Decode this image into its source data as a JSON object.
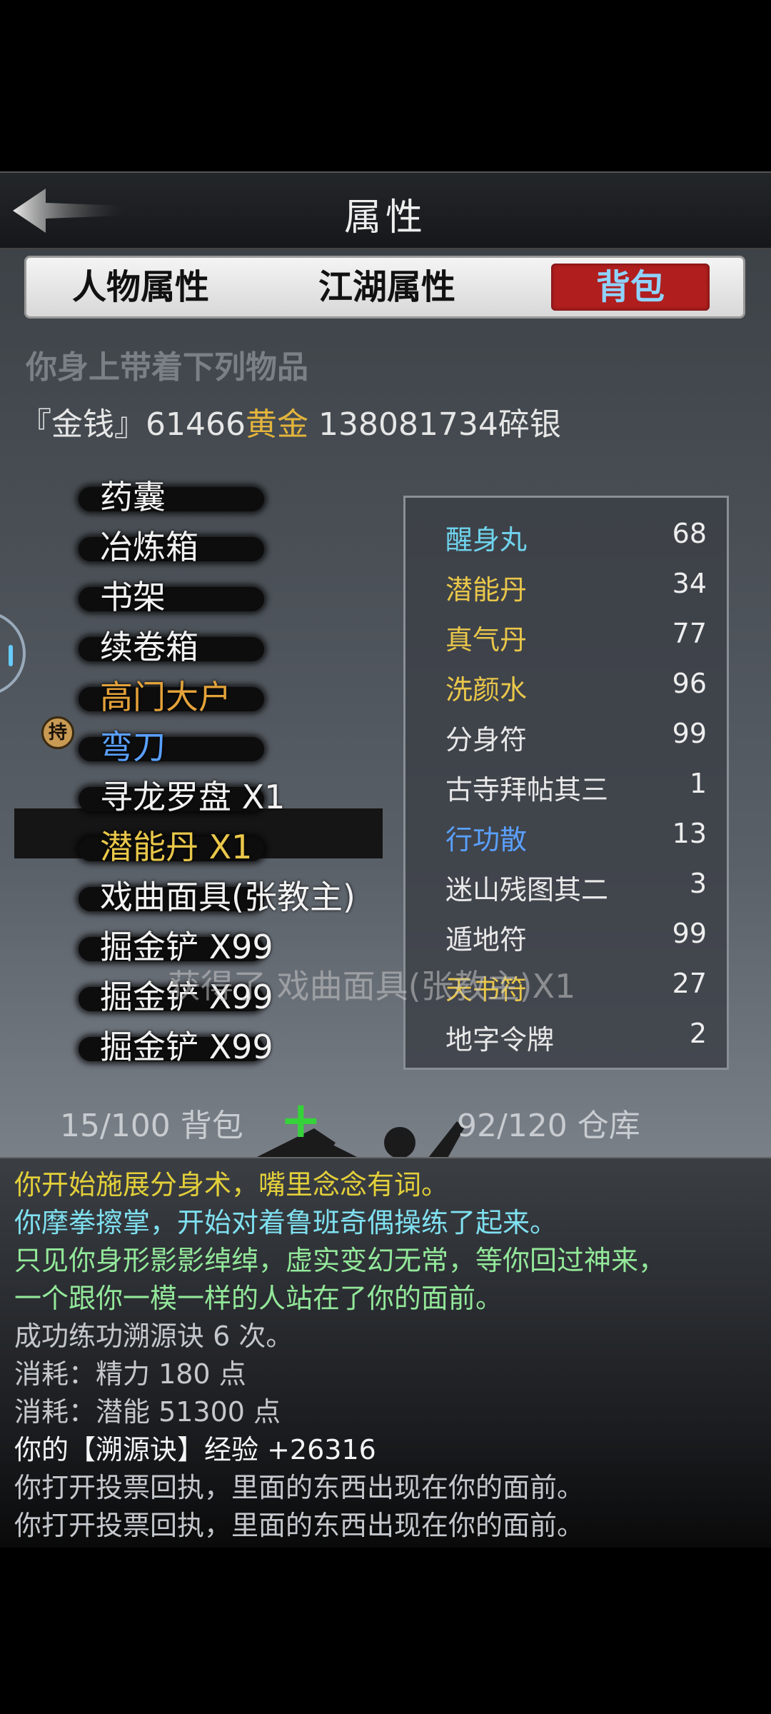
{
  "header": {
    "title": "属性"
  },
  "tabs": [
    {
      "label": "人物属性",
      "active": false
    },
    {
      "label": "江湖属性",
      "active": false
    },
    {
      "label": "背包",
      "active": true
    }
  ],
  "subtitle": "你身上带着下列物品",
  "money": {
    "prefix": "『金钱』61466",
    "gold_label": "黄金",
    "suffix": " 138081734碎银"
  },
  "equip_badge": "持",
  "items": [
    {
      "label": "药囊",
      "color": "#f2f2f2"
    },
    {
      "label": "冶炼箱",
      "color": "#f2f2f2"
    },
    {
      "label": "书架",
      "color": "#f2f2f2"
    },
    {
      "label": "续卷箱",
      "color": "#f2f2f2"
    },
    {
      "label": "高门大户",
      "color": "#e3a23a"
    },
    {
      "label": "弯刀",
      "color": "#5aa0ff"
    },
    {
      "label": "寻龙罗盘 X1",
      "color": "#f2f2f2"
    },
    {
      "label": "潜能丹 X1",
      "color": "#e9c74a"
    },
    {
      "label": "戏曲面具(张教主)",
      "color": "#f2f2f2"
    },
    {
      "label": "掘金铲 X99",
      "color": "#f2f2f2"
    },
    {
      "label": "掘金铲 X99",
      "color": "#f2f2f2"
    },
    {
      "label": "掘金铲 X99",
      "color": "#f2f2f2"
    }
  ],
  "quick_items": [
    {
      "name": "醒身丸",
      "count": "68",
      "color": "#6fd4ee"
    },
    {
      "name": "潜能丹",
      "count": "34",
      "color": "#e9c74a"
    },
    {
      "name": "真气丹",
      "count": "77",
      "color": "#e9c74a"
    },
    {
      "name": "洗颜水",
      "count": "96",
      "color": "#e9c74a"
    },
    {
      "name": "分身符",
      "count": "99",
      "color": "#e8e8e8"
    },
    {
      "name": "古寺拜帖其三",
      "count": "1",
      "color": "#e8e8e8"
    },
    {
      "name": "行功散",
      "count": "13",
      "color": "#5aa0ff"
    },
    {
      "name": "迷山残图其二",
      "count": "3",
      "color": "#e8e8e8"
    },
    {
      "name": "遁地符",
      "count": "99",
      "color": "#e8e8e8"
    },
    {
      "name": "天书符",
      "count": "27",
      "color": "#e9c74a"
    },
    {
      "name": "地字令牌",
      "count": "2",
      "color": "#e8e8e8"
    }
  ],
  "overlay_message": "获得了 戏曲面具(张教主)X1",
  "bag_count": "15/100 背包",
  "warehouse_count": "92/120 仓库",
  "log": [
    {
      "text": "你开始施展分身术，嘴里念念有词。",
      "cls": "l-yellow"
    },
    {
      "text": "你摩拳擦掌，开始对着鲁班奇偶操练了起来。",
      "cls": "l-cyan"
    },
    {
      "text": "只见你身形影影绰绰，虚实变幻无常，等你回过神来，",
      "cls": "l-green"
    },
    {
      "text": "一个跟你一模一样的人站在了你的面前。",
      "cls": "l-green"
    },
    {
      "text": "成功练功溯源诀 6 次。",
      "cls": "l-grey"
    },
    {
      "text": "消耗：精力 180 点",
      "cls": "l-grey"
    },
    {
      "text": "消耗：潜能 51300 点",
      "cls": "l-grey"
    },
    {
      "text": "你的【溯源诀】经验 +26316",
      "cls": "l-white"
    },
    {
      "text": "你打开投票回执，里面的东西出现在你的面前。",
      "cls": "l-grey"
    },
    {
      "text": "你打开投票回执，里面的东西出现在你的面前。",
      "cls": "l-grey"
    }
  ]
}
